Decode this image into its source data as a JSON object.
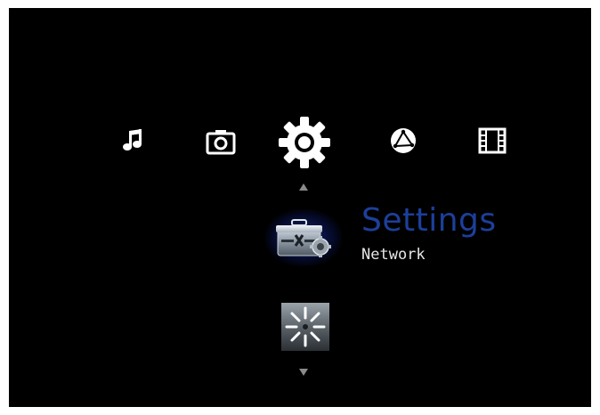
{
  "categories": [
    {
      "id": "music",
      "icon": "music-note-icon"
    },
    {
      "id": "photo",
      "icon": "camera-icon"
    },
    {
      "id": "settings",
      "icon": "gear-icon",
      "selected": true
    },
    {
      "id": "online",
      "icon": "globe-icon"
    },
    {
      "id": "video",
      "icon": "film-strip-icon"
    }
  ],
  "menu": {
    "selected_title": "Settings",
    "selected_subtitle": "Network",
    "selected_item_icon": "network-toolbox-icon",
    "next_item_icon": "loading-spinner-icon"
  },
  "colors": {
    "background": "#000000",
    "title": "#1c3f9a",
    "subtitle": "#e6e6e6",
    "icon": "#ffffff",
    "selection_glow": "#2846dc"
  }
}
